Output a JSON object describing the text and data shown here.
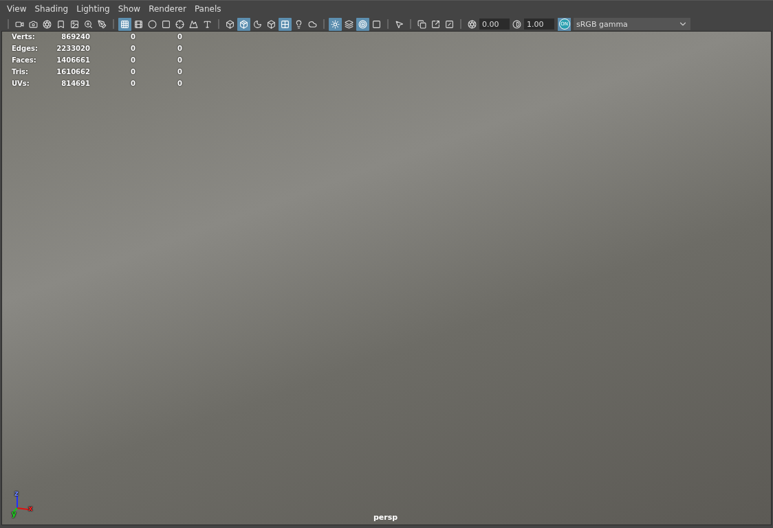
{
  "menu": [
    "View",
    "Shading",
    "Lighting",
    "Show",
    "Renderer",
    "Panels"
  ],
  "toolbar": [
    {
      "kind": "icons",
      "buttons": [
        {
          "selected": false
        },
        {
          "selected": false
        },
        {
          "selected": false
        },
        {
          "selected": false
        },
        {
          "selected": false
        },
        {
          "selected": false
        },
        {
          "selected": false
        }
      ]
    },
    {
      "kind": "icons",
      "buttons": [
        {
          "selected": true
        },
        {
          "selected": false
        },
        {
          "selected": false
        },
        {
          "selected": false
        },
        {
          "selected": false
        },
        {
          "selected": false
        },
        {
          "selected": false
        }
      ]
    },
    {
      "kind": "icons",
      "buttons": [
        {
          "selected": false
        },
        {
          "selected": true
        },
        {
          "selected": false
        },
        {
          "selected": false
        },
        {
          "selected": true
        },
        {
          "selected": false
        },
        {
          "selected": false
        }
      ]
    },
    {
      "kind": "icons",
      "buttons": [
        {
          "selected": true
        },
        {
          "selected": false
        },
        {
          "selected": true
        },
        {
          "selected": false
        }
      ]
    },
    {
      "kind": "icons",
      "buttons": [
        {
          "selected": false
        }
      ]
    },
    {
      "kind": "icons",
      "buttons": [
        {
          "selected": false
        },
        {
          "selected": false
        },
        {
          "selected": false
        }
      ]
    },
    {
      "kind": "color",
      "exposure": "0.00",
      "gamma": "1.00",
      "toggle": {
        "label": "ON",
        "selected": true
      },
      "view_transform": "sRGB gamma"
    }
  ],
  "stats": [
    {
      "label": "Verts:",
      "value": "869240",
      "column_3": "0",
      "column_4": "0"
    },
    {
      "label": "Edges:",
      "value": "2233020",
      "column_3": "0",
      "column_4": "0"
    },
    {
      "label": "Faces:",
      "value": "1406661",
      "column_3": "0",
      "column_4": "0"
    },
    {
      "label": "Tris:",
      "value": "1610662",
      "column_3": "0",
      "column_4": "0"
    },
    {
      "label": "UVs:",
      "value": "814691",
      "column_3": "0",
      "column_4": "0"
    }
  ],
  "axes": {
    "x": "x",
    "y": "y",
    "z": "z"
  },
  "camera": "persp"
}
